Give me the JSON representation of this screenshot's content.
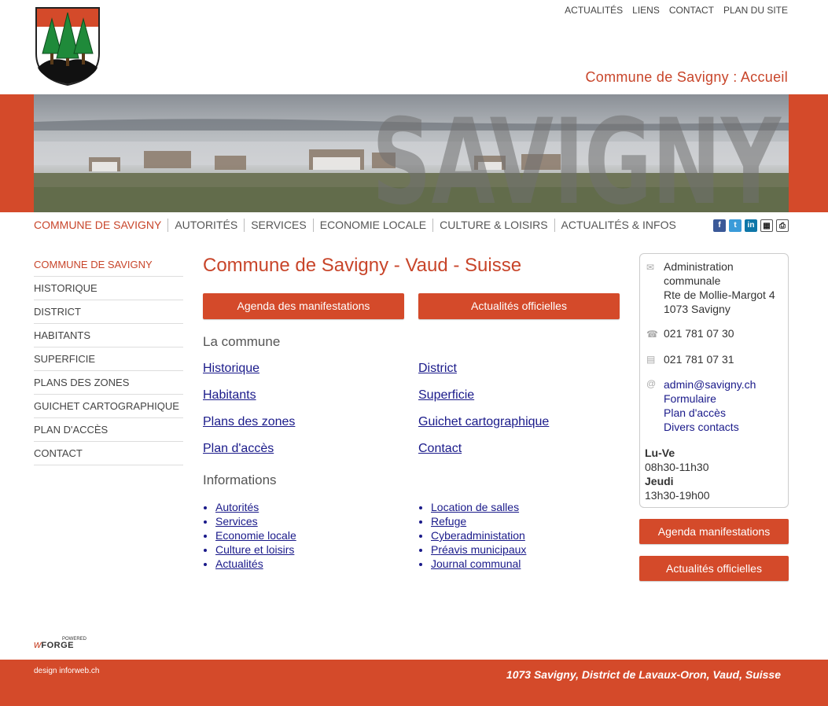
{
  "header": {
    "top_links": [
      "ACTUALITÉS",
      "LIENS",
      "CONTACT",
      "PLAN DU SITE"
    ],
    "page_heading": "Commune de Savigny : Accueil",
    "banner_text": "SAVIGNY"
  },
  "main_nav": [
    "COMMUNE DE SAVIGNY",
    "AUTORITÉS",
    "SERVICES",
    "ECONOMIE LOCALE",
    "CULTURE & LOISIRS",
    "ACTUALITÉS & INFOS"
  ],
  "sidebar": [
    "COMMUNE DE SAVIGNY",
    "HISTORIQUE",
    "DISTRICT",
    "HABITANTS",
    "SUPERFICIE",
    "PLANS DES ZONES",
    "GUICHET CARTOGRAPHIQUE",
    "PLAN D'ACCÈS",
    "CONTACT"
  ],
  "content": {
    "title": "Commune de Savigny - Vaud - Suisse",
    "btn_agenda": "Agenda des manifestations",
    "btn_actualites": "Actualités officielles",
    "section_commune": "La commune",
    "commune_links": [
      "Historique",
      "District",
      "Habitants",
      "Superficie",
      "Plans des zones",
      "Guichet cartographique",
      "Plan d'accès",
      "Contact"
    ],
    "section_info": "Informations",
    "info_left": [
      "Autorités",
      "Services",
      "Economie locale",
      "Culture et loisirs",
      "Actualités"
    ],
    "info_right": [
      "Location de salles",
      "Refuge",
      "Cyberadministation",
      "Préavis municipaux",
      "Journal communal"
    ]
  },
  "contact": {
    "admin_lines": [
      "Administration",
      "communale",
      "Rte de Mollie-Margot 4",
      "1073 Savigny"
    ],
    "phone": "021 781 07 30",
    "fax": "021 781 07 31",
    "email": "admin@savigny.ch",
    "links": [
      "Formulaire",
      "Plan d'accès",
      "Divers contacts"
    ],
    "hours_day1": "Lu-Ve",
    "hours_time1": "08h30-11h30",
    "hours_day2": "Jeudi",
    "hours_time2": "13h30-19h00"
  },
  "side_buttons": {
    "agenda": "Agenda manifestations",
    "actualites": "Actualités officielles"
  },
  "footer": {
    "powered": "POWERED",
    "webforge": "FORGE",
    "design": "design inforweb.ch",
    "address": "1073 Savigny, District de Lavaux-Oron, Vaud, Suisse"
  },
  "colors": {
    "accent": "#d44a2a",
    "link": "#1a1a8a"
  }
}
